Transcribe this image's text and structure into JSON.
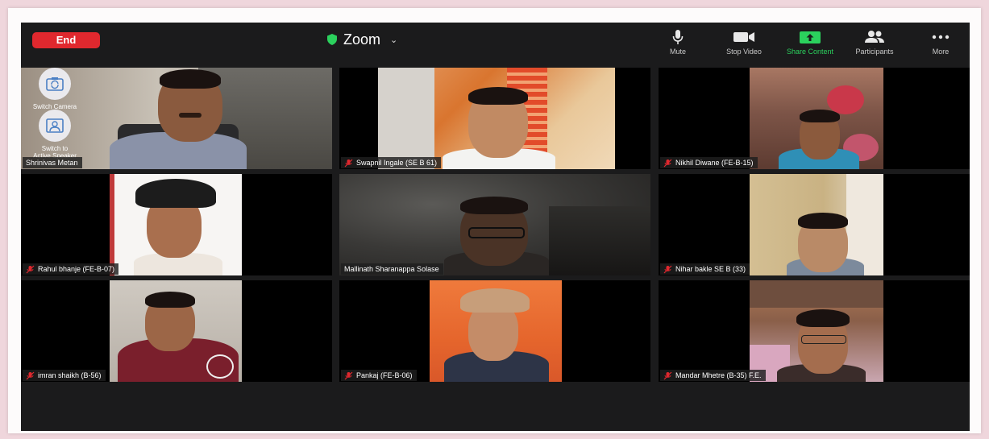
{
  "toolbar": {
    "end_label": "End",
    "title": "Zoom",
    "mute_label": "Mute",
    "stop_video_label": "Stop Video",
    "share_label": "Share Content",
    "participants_label": "Participants",
    "more_label": "More"
  },
  "self_view": {
    "switch_camera_label": "Switch Camera",
    "switch_speaker_label_line1": "Switch to",
    "switch_speaker_label_line2": "Active Speaker"
  },
  "participants": [
    {
      "name": "Shrinivas Metan",
      "muted": false
    },
    {
      "name": "Swapnil Ingale (SE B 61)",
      "muted": true
    },
    {
      "name": "Nikhil Diwane (FE-B-15)",
      "muted": true
    },
    {
      "name": "Rahul bhanje (FE-B-07)",
      "muted": true
    },
    {
      "name": "Mallinath Sharanappa Solase",
      "muted": false
    },
    {
      "name": "Nihar bakle SE B (33)",
      "muted": true
    },
    {
      "name": "imran shaikh (B-56)",
      "muted": true
    },
    {
      "name": "Pankaj (FE-B-06)",
      "muted": true
    },
    {
      "name": "Mandar Mhetre (B-35) F.E.",
      "muted": true
    }
  ],
  "colors": {
    "end_button": "#e0282e",
    "share_green": "#2bd15d",
    "active_speaker_border": "#2fd055",
    "muted_red": "#e0282e"
  }
}
